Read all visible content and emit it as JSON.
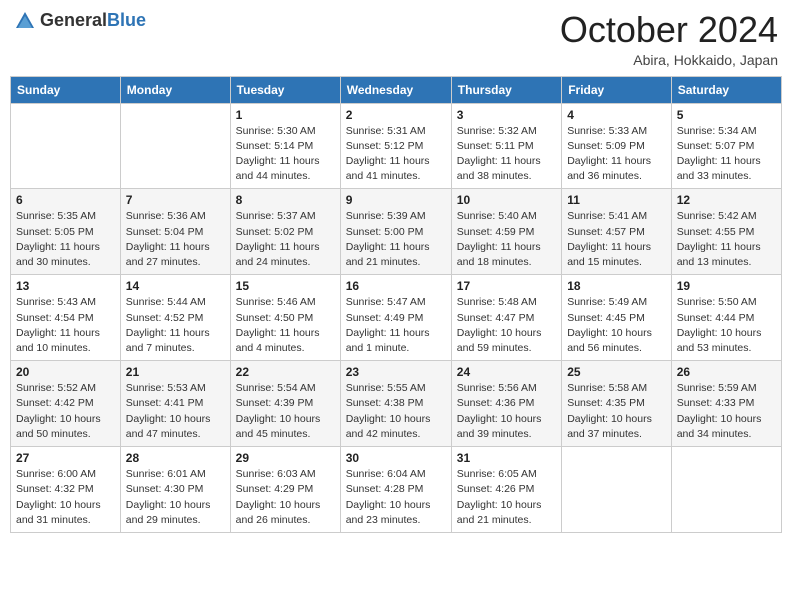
{
  "header": {
    "logo_general": "General",
    "logo_blue": "Blue",
    "month": "October 2024",
    "location": "Abira, Hokkaido, Japan"
  },
  "weekdays": [
    "Sunday",
    "Monday",
    "Tuesday",
    "Wednesday",
    "Thursday",
    "Friday",
    "Saturday"
  ],
  "weeks": [
    [
      {
        "day": "",
        "info": ""
      },
      {
        "day": "",
        "info": ""
      },
      {
        "day": "1",
        "info": "Sunrise: 5:30 AM\nSunset: 5:14 PM\nDaylight: 11 hours and 44 minutes."
      },
      {
        "day": "2",
        "info": "Sunrise: 5:31 AM\nSunset: 5:12 PM\nDaylight: 11 hours and 41 minutes."
      },
      {
        "day": "3",
        "info": "Sunrise: 5:32 AM\nSunset: 5:11 PM\nDaylight: 11 hours and 38 minutes."
      },
      {
        "day": "4",
        "info": "Sunrise: 5:33 AM\nSunset: 5:09 PM\nDaylight: 11 hours and 36 minutes."
      },
      {
        "day": "5",
        "info": "Sunrise: 5:34 AM\nSunset: 5:07 PM\nDaylight: 11 hours and 33 minutes."
      }
    ],
    [
      {
        "day": "6",
        "info": "Sunrise: 5:35 AM\nSunset: 5:05 PM\nDaylight: 11 hours and 30 minutes."
      },
      {
        "day": "7",
        "info": "Sunrise: 5:36 AM\nSunset: 5:04 PM\nDaylight: 11 hours and 27 minutes."
      },
      {
        "day": "8",
        "info": "Sunrise: 5:37 AM\nSunset: 5:02 PM\nDaylight: 11 hours and 24 minutes."
      },
      {
        "day": "9",
        "info": "Sunrise: 5:39 AM\nSunset: 5:00 PM\nDaylight: 11 hours and 21 minutes."
      },
      {
        "day": "10",
        "info": "Sunrise: 5:40 AM\nSunset: 4:59 PM\nDaylight: 11 hours and 18 minutes."
      },
      {
        "day": "11",
        "info": "Sunrise: 5:41 AM\nSunset: 4:57 PM\nDaylight: 11 hours and 15 minutes."
      },
      {
        "day": "12",
        "info": "Sunrise: 5:42 AM\nSunset: 4:55 PM\nDaylight: 11 hours and 13 minutes."
      }
    ],
    [
      {
        "day": "13",
        "info": "Sunrise: 5:43 AM\nSunset: 4:54 PM\nDaylight: 11 hours and 10 minutes."
      },
      {
        "day": "14",
        "info": "Sunrise: 5:44 AM\nSunset: 4:52 PM\nDaylight: 11 hours and 7 minutes."
      },
      {
        "day": "15",
        "info": "Sunrise: 5:46 AM\nSunset: 4:50 PM\nDaylight: 11 hours and 4 minutes."
      },
      {
        "day": "16",
        "info": "Sunrise: 5:47 AM\nSunset: 4:49 PM\nDaylight: 11 hours and 1 minute."
      },
      {
        "day": "17",
        "info": "Sunrise: 5:48 AM\nSunset: 4:47 PM\nDaylight: 10 hours and 59 minutes."
      },
      {
        "day": "18",
        "info": "Sunrise: 5:49 AM\nSunset: 4:45 PM\nDaylight: 10 hours and 56 minutes."
      },
      {
        "day": "19",
        "info": "Sunrise: 5:50 AM\nSunset: 4:44 PM\nDaylight: 10 hours and 53 minutes."
      }
    ],
    [
      {
        "day": "20",
        "info": "Sunrise: 5:52 AM\nSunset: 4:42 PM\nDaylight: 10 hours and 50 minutes."
      },
      {
        "day": "21",
        "info": "Sunrise: 5:53 AM\nSunset: 4:41 PM\nDaylight: 10 hours and 47 minutes."
      },
      {
        "day": "22",
        "info": "Sunrise: 5:54 AM\nSunset: 4:39 PM\nDaylight: 10 hours and 45 minutes."
      },
      {
        "day": "23",
        "info": "Sunrise: 5:55 AM\nSunset: 4:38 PM\nDaylight: 10 hours and 42 minutes."
      },
      {
        "day": "24",
        "info": "Sunrise: 5:56 AM\nSunset: 4:36 PM\nDaylight: 10 hours and 39 minutes."
      },
      {
        "day": "25",
        "info": "Sunrise: 5:58 AM\nSunset: 4:35 PM\nDaylight: 10 hours and 37 minutes."
      },
      {
        "day": "26",
        "info": "Sunrise: 5:59 AM\nSunset: 4:33 PM\nDaylight: 10 hours and 34 minutes."
      }
    ],
    [
      {
        "day": "27",
        "info": "Sunrise: 6:00 AM\nSunset: 4:32 PM\nDaylight: 10 hours and 31 minutes."
      },
      {
        "day": "28",
        "info": "Sunrise: 6:01 AM\nSunset: 4:30 PM\nDaylight: 10 hours and 29 minutes."
      },
      {
        "day": "29",
        "info": "Sunrise: 6:03 AM\nSunset: 4:29 PM\nDaylight: 10 hours and 26 minutes."
      },
      {
        "day": "30",
        "info": "Sunrise: 6:04 AM\nSunset: 4:28 PM\nDaylight: 10 hours and 23 minutes."
      },
      {
        "day": "31",
        "info": "Sunrise: 6:05 AM\nSunset: 4:26 PM\nDaylight: 10 hours and 21 minutes."
      },
      {
        "day": "",
        "info": ""
      },
      {
        "day": "",
        "info": ""
      }
    ]
  ]
}
